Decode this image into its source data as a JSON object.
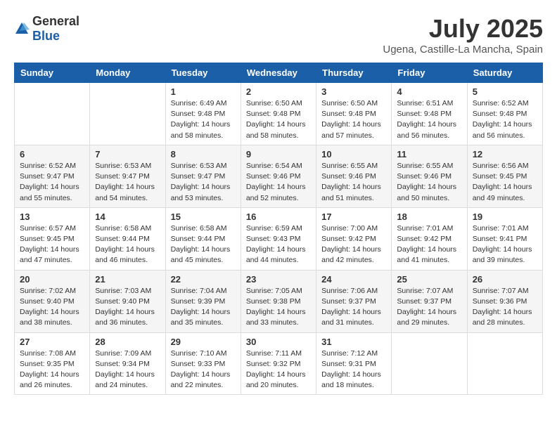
{
  "logo": {
    "general": "General",
    "blue": "Blue"
  },
  "title": "July 2025",
  "subtitle": "Ugena, Castille-La Mancha, Spain",
  "weekdays": [
    "Sunday",
    "Monday",
    "Tuesday",
    "Wednesday",
    "Thursday",
    "Friday",
    "Saturday"
  ],
  "weeks": [
    [
      {
        "day": "",
        "sunrise": "",
        "sunset": "",
        "daylight": ""
      },
      {
        "day": "",
        "sunrise": "",
        "sunset": "",
        "daylight": ""
      },
      {
        "day": "1",
        "sunrise": "Sunrise: 6:49 AM",
        "sunset": "Sunset: 9:48 PM",
        "daylight": "Daylight: 14 hours and 58 minutes."
      },
      {
        "day": "2",
        "sunrise": "Sunrise: 6:50 AM",
        "sunset": "Sunset: 9:48 PM",
        "daylight": "Daylight: 14 hours and 58 minutes."
      },
      {
        "day": "3",
        "sunrise": "Sunrise: 6:50 AM",
        "sunset": "Sunset: 9:48 PM",
        "daylight": "Daylight: 14 hours and 57 minutes."
      },
      {
        "day": "4",
        "sunrise": "Sunrise: 6:51 AM",
        "sunset": "Sunset: 9:48 PM",
        "daylight": "Daylight: 14 hours and 56 minutes."
      },
      {
        "day": "5",
        "sunrise": "Sunrise: 6:52 AM",
        "sunset": "Sunset: 9:48 PM",
        "daylight": "Daylight: 14 hours and 56 minutes."
      }
    ],
    [
      {
        "day": "6",
        "sunrise": "Sunrise: 6:52 AM",
        "sunset": "Sunset: 9:47 PM",
        "daylight": "Daylight: 14 hours and 55 minutes."
      },
      {
        "day": "7",
        "sunrise": "Sunrise: 6:53 AM",
        "sunset": "Sunset: 9:47 PM",
        "daylight": "Daylight: 14 hours and 54 minutes."
      },
      {
        "day": "8",
        "sunrise": "Sunrise: 6:53 AM",
        "sunset": "Sunset: 9:47 PM",
        "daylight": "Daylight: 14 hours and 53 minutes."
      },
      {
        "day": "9",
        "sunrise": "Sunrise: 6:54 AM",
        "sunset": "Sunset: 9:46 PM",
        "daylight": "Daylight: 14 hours and 52 minutes."
      },
      {
        "day": "10",
        "sunrise": "Sunrise: 6:55 AM",
        "sunset": "Sunset: 9:46 PM",
        "daylight": "Daylight: 14 hours and 51 minutes."
      },
      {
        "day": "11",
        "sunrise": "Sunrise: 6:55 AM",
        "sunset": "Sunset: 9:46 PM",
        "daylight": "Daylight: 14 hours and 50 minutes."
      },
      {
        "day": "12",
        "sunrise": "Sunrise: 6:56 AM",
        "sunset": "Sunset: 9:45 PM",
        "daylight": "Daylight: 14 hours and 49 minutes."
      }
    ],
    [
      {
        "day": "13",
        "sunrise": "Sunrise: 6:57 AM",
        "sunset": "Sunset: 9:45 PM",
        "daylight": "Daylight: 14 hours and 47 minutes."
      },
      {
        "day": "14",
        "sunrise": "Sunrise: 6:58 AM",
        "sunset": "Sunset: 9:44 PM",
        "daylight": "Daylight: 14 hours and 46 minutes."
      },
      {
        "day": "15",
        "sunrise": "Sunrise: 6:58 AM",
        "sunset": "Sunset: 9:44 PM",
        "daylight": "Daylight: 14 hours and 45 minutes."
      },
      {
        "day": "16",
        "sunrise": "Sunrise: 6:59 AM",
        "sunset": "Sunset: 9:43 PM",
        "daylight": "Daylight: 14 hours and 44 minutes."
      },
      {
        "day": "17",
        "sunrise": "Sunrise: 7:00 AM",
        "sunset": "Sunset: 9:42 PM",
        "daylight": "Daylight: 14 hours and 42 minutes."
      },
      {
        "day": "18",
        "sunrise": "Sunrise: 7:01 AM",
        "sunset": "Sunset: 9:42 PM",
        "daylight": "Daylight: 14 hours and 41 minutes."
      },
      {
        "day": "19",
        "sunrise": "Sunrise: 7:01 AM",
        "sunset": "Sunset: 9:41 PM",
        "daylight": "Daylight: 14 hours and 39 minutes."
      }
    ],
    [
      {
        "day": "20",
        "sunrise": "Sunrise: 7:02 AM",
        "sunset": "Sunset: 9:40 PM",
        "daylight": "Daylight: 14 hours and 38 minutes."
      },
      {
        "day": "21",
        "sunrise": "Sunrise: 7:03 AM",
        "sunset": "Sunset: 9:40 PM",
        "daylight": "Daylight: 14 hours and 36 minutes."
      },
      {
        "day": "22",
        "sunrise": "Sunrise: 7:04 AM",
        "sunset": "Sunset: 9:39 PM",
        "daylight": "Daylight: 14 hours and 35 minutes."
      },
      {
        "day": "23",
        "sunrise": "Sunrise: 7:05 AM",
        "sunset": "Sunset: 9:38 PM",
        "daylight": "Daylight: 14 hours and 33 minutes."
      },
      {
        "day": "24",
        "sunrise": "Sunrise: 7:06 AM",
        "sunset": "Sunset: 9:37 PM",
        "daylight": "Daylight: 14 hours and 31 minutes."
      },
      {
        "day": "25",
        "sunrise": "Sunrise: 7:07 AM",
        "sunset": "Sunset: 9:37 PM",
        "daylight": "Daylight: 14 hours and 29 minutes."
      },
      {
        "day": "26",
        "sunrise": "Sunrise: 7:07 AM",
        "sunset": "Sunset: 9:36 PM",
        "daylight": "Daylight: 14 hours and 28 minutes."
      }
    ],
    [
      {
        "day": "27",
        "sunrise": "Sunrise: 7:08 AM",
        "sunset": "Sunset: 9:35 PM",
        "daylight": "Daylight: 14 hours and 26 minutes."
      },
      {
        "day": "28",
        "sunrise": "Sunrise: 7:09 AM",
        "sunset": "Sunset: 9:34 PM",
        "daylight": "Daylight: 14 hours and 24 minutes."
      },
      {
        "day": "29",
        "sunrise": "Sunrise: 7:10 AM",
        "sunset": "Sunset: 9:33 PM",
        "daylight": "Daylight: 14 hours and 22 minutes."
      },
      {
        "day": "30",
        "sunrise": "Sunrise: 7:11 AM",
        "sunset": "Sunset: 9:32 PM",
        "daylight": "Daylight: 14 hours and 20 minutes."
      },
      {
        "day": "31",
        "sunrise": "Sunrise: 7:12 AM",
        "sunset": "Sunset: 9:31 PM",
        "daylight": "Daylight: 14 hours and 18 minutes."
      },
      {
        "day": "",
        "sunrise": "",
        "sunset": "",
        "daylight": ""
      },
      {
        "day": "",
        "sunrise": "",
        "sunset": "",
        "daylight": ""
      }
    ]
  ]
}
